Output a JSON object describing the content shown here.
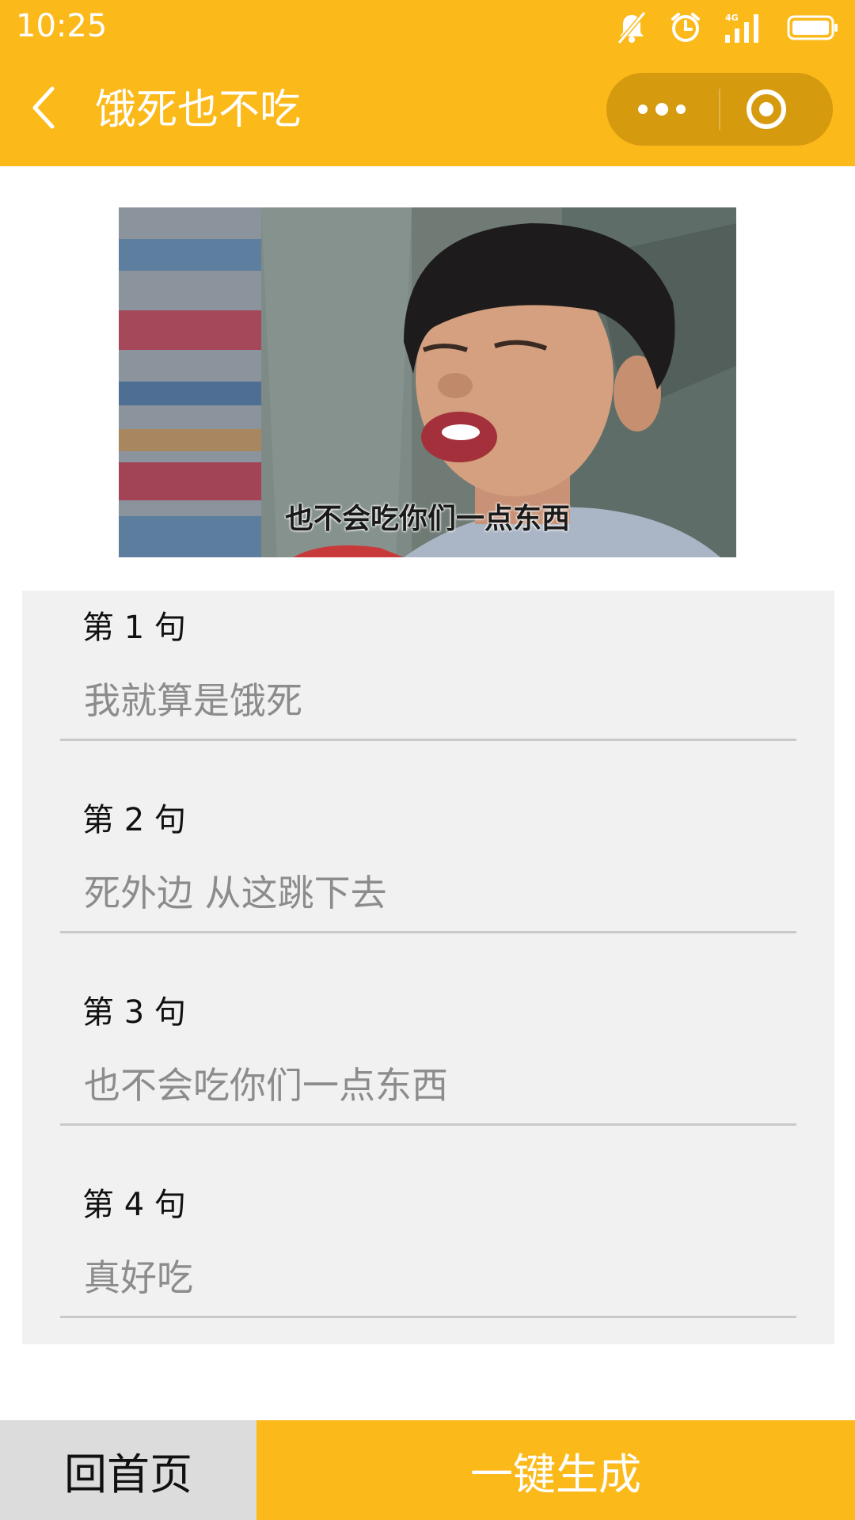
{
  "status_bar": {
    "time": "10:25",
    "network_label": "4G"
  },
  "nav": {
    "title": "饿死也不吃"
  },
  "meme": {
    "caption": "也不会吃你们一点东西"
  },
  "form": {
    "fields": [
      {
        "label": "第 1 句",
        "placeholder": "我就算是饿死"
      },
      {
        "label": "第 2 句",
        "placeholder": "死外边 从这跳下去"
      },
      {
        "label": "第 3 句",
        "placeholder": "也不会吃你们一点东西"
      },
      {
        "label": "第 4 句",
        "placeholder": "真好吃"
      }
    ]
  },
  "bottom": {
    "home_label": "回首页",
    "generate_label": "一键生成"
  },
  "colors": {
    "accent": "#FBB91A",
    "capsule": "#D69A0F",
    "panel": "#F1F1F1",
    "home_button": "#DCDCDC"
  }
}
